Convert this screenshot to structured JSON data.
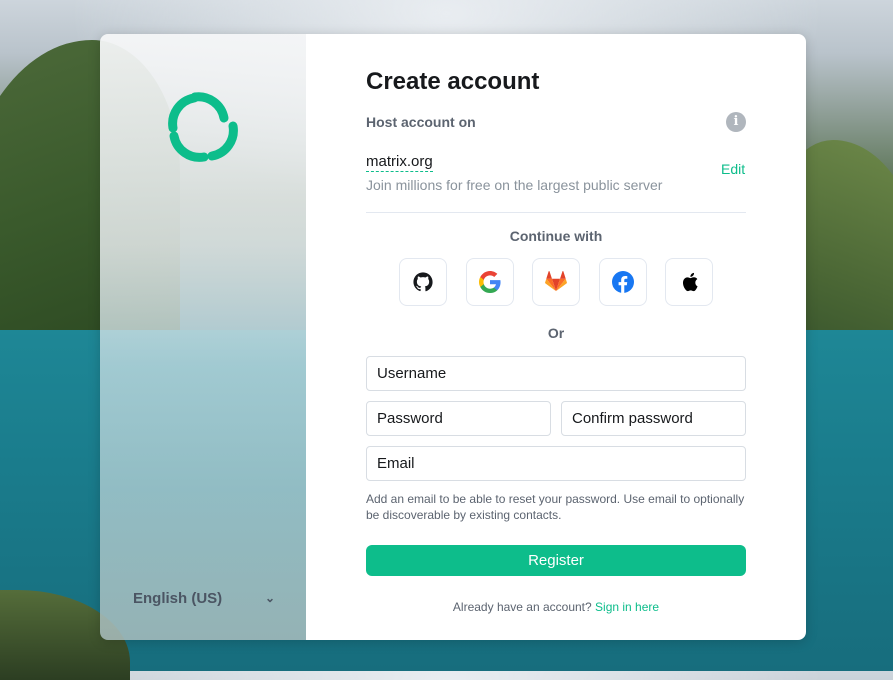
{
  "brand": {
    "accent_color": "#0dbd8b",
    "logo_icon": "element-logo-icon"
  },
  "language": {
    "selected": "English (US)",
    "icon": "chevron-down-icon"
  },
  "form": {
    "title": "Create account",
    "host_label": "Host account on",
    "info_icon": "info-icon",
    "server": {
      "name": "matrix.org",
      "description": "Join millions for free on the largest public server",
      "edit_label": "Edit"
    },
    "sso": {
      "label": "Continue with",
      "providers": [
        {
          "name": "GitHub",
          "icon": "github-icon"
        },
        {
          "name": "Google",
          "icon": "google-icon"
        },
        {
          "name": "GitLab",
          "icon": "gitlab-icon"
        },
        {
          "name": "Facebook",
          "icon": "facebook-icon"
        },
        {
          "name": "Apple",
          "icon": "apple-icon"
        }
      ]
    },
    "or_label": "Or",
    "fields": {
      "username": {
        "placeholder": "Username",
        "value": ""
      },
      "password": {
        "placeholder": "Password",
        "value": ""
      },
      "confirm_password": {
        "placeholder": "Confirm password",
        "value": ""
      },
      "email": {
        "placeholder": "Email",
        "value": ""
      }
    },
    "email_help": "Add an email to be able to reset your password. Use email to optionally be discoverable by existing contacts.",
    "register_label": "Register",
    "signin_prompt": "Already have an account?",
    "signin_link": "Sign in here"
  }
}
